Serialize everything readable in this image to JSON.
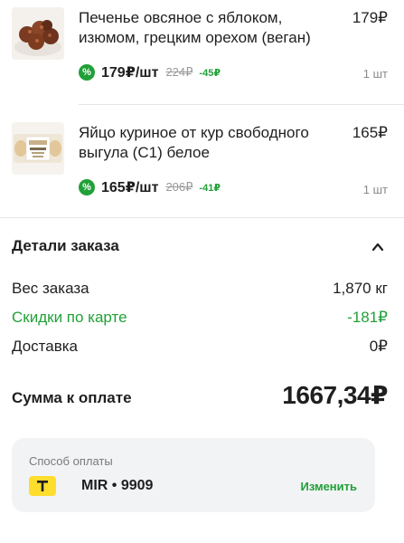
{
  "items": [
    {
      "name": "Печенье овсяное с яблоком, изюмом, грецким орехом (веган)",
      "total": "179₽",
      "unit_price": "179₽/шт",
      "old_price": "224₽",
      "discount": "-45₽",
      "quantity": "1 шт",
      "image_icon": "cookies-product-image"
    },
    {
      "name": "Яйцо куриное от кур свободного выгула (С1) белое",
      "total": "165₽",
      "unit_price": "165₽/шт",
      "old_price": "206₽",
      "discount": "-41₽",
      "quantity": "1 шт",
      "image_icon": "eggs-product-image"
    }
  ],
  "discount_icon_glyph": "%",
  "order_details": {
    "title": "Детали заказа",
    "weight_label": "Вес заказа",
    "weight_value": "1,870 кг",
    "card_discount_label": "Скидки по карте",
    "card_discount_value": "-181₽",
    "delivery_label": "Доставка",
    "delivery_value": "0₽",
    "total_label": "Сумма к оплате",
    "total_value": "1667,34₽"
  },
  "payment": {
    "title": "Способ оплаты",
    "card": "MIR • 9909",
    "change_label": "Изменить",
    "bank_logo_letter": "T"
  },
  "colors": {
    "accent_green": "#21a038",
    "bank_yellow": "#ffdd2d"
  }
}
